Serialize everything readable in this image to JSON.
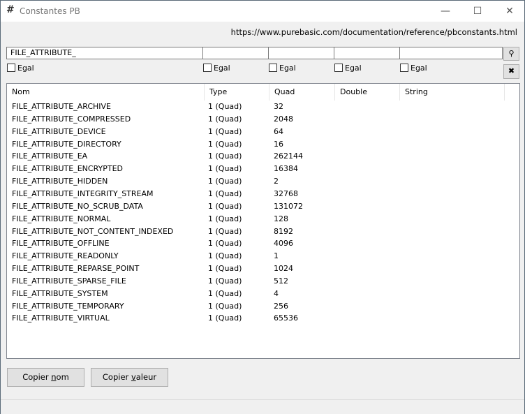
{
  "window": {
    "title": "Constantes PB",
    "icon": "hash-icon",
    "minimize": "—",
    "maximize": "☐",
    "close": "✕"
  },
  "url": "https://www.purebasic.com/documentation/reference/pbconstants.html",
  "filters": [
    {
      "value": "FILE_ATTRIBUTE_",
      "equal_label": "Egal"
    },
    {
      "value": "",
      "equal_label": "Egal"
    },
    {
      "value": "",
      "equal_label": "Egal"
    },
    {
      "value": "",
      "equal_label": "Egal"
    },
    {
      "value": "",
      "equal_label": "Egal"
    }
  ],
  "search_button": "⚲",
  "clear_button": "✖",
  "columns": [
    "Nom",
    "Type",
    "Quad",
    "Double",
    "String"
  ],
  "rows": [
    [
      "FILE_ATTRIBUTE_ARCHIVE",
      "1 (Quad)",
      "32"
    ],
    [
      "FILE_ATTRIBUTE_COMPRESSED",
      "1 (Quad)",
      "2048"
    ],
    [
      "FILE_ATTRIBUTE_DEVICE",
      "1 (Quad)",
      "64"
    ],
    [
      "FILE_ATTRIBUTE_DIRECTORY",
      "1 (Quad)",
      "16"
    ],
    [
      "FILE_ATTRIBUTE_EA",
      "1 (Quad)",
      "262144"
    ],
    [
      "FILE_ATTRIBUTE_ENCRYPTED",
      "1 (Quad)",
      "16384"
    ],
    [
      "FILE_ATTRIBUTE_HIDDEN",
      "1 (Quad)",
      "2"
    ],
    [
      "FILE_ATTRIBUTE_INTEGRITY_STREAM",
      "1 (Quad)",
      "32768"
    ],
    [
      "FILE_ATTRIBUTE_NO_SCRUB_DATA",
      "1 (Quad)",
      "131072"
    ],
    [
      "FILE_ATTRIBUTE_NORMAL",
      "1 (Quad)",
      "128"
    ],
    [
      "FILE_ATTRIBUTE_NOT_CONTENT_INDEXED",
      "1 (Quad)",
      "8192"
    ],
    [
      "FILE_ATTRIBUTE_OFFLINE",
      "1 (Quad)",
      "4096"
    ],
    [
      "FILE_ATTRIBUTE_READONLY",
      "1 (Quad)",
      "1"
    ],
    [
      "FILE_ATTRIBUTE_REPARSE_POINT",
      "1 (Quad)",
      "1024"
    ],
    [
      "FILE_ATTRIBUTE_SPARSE_FILE",
      "1 (Quad)",
      "512"
    ],
    [
      "FILE_ATTRIBUTE_SYSTEM",
      "1 (Quad)",
      "4"
    ],
    [
      "FILE_ATTRIBUTE_TEMPORARY",
      "1 (Quad)",
      "256"
    ],
    [
      "FILE_ATTRIBUTE_VIRTUAL",
      "1 (Quad)",
      "65536"
    ]
  ],
  "buttons": {
    "copy_name": {
      "pre": "Copier ",
      "key": "n",
      "post": "om"
    },
    "copy_value": {
      "pre": "Copier ",
      "key": "v",
      "post": "aleur"
    }
  }
}
